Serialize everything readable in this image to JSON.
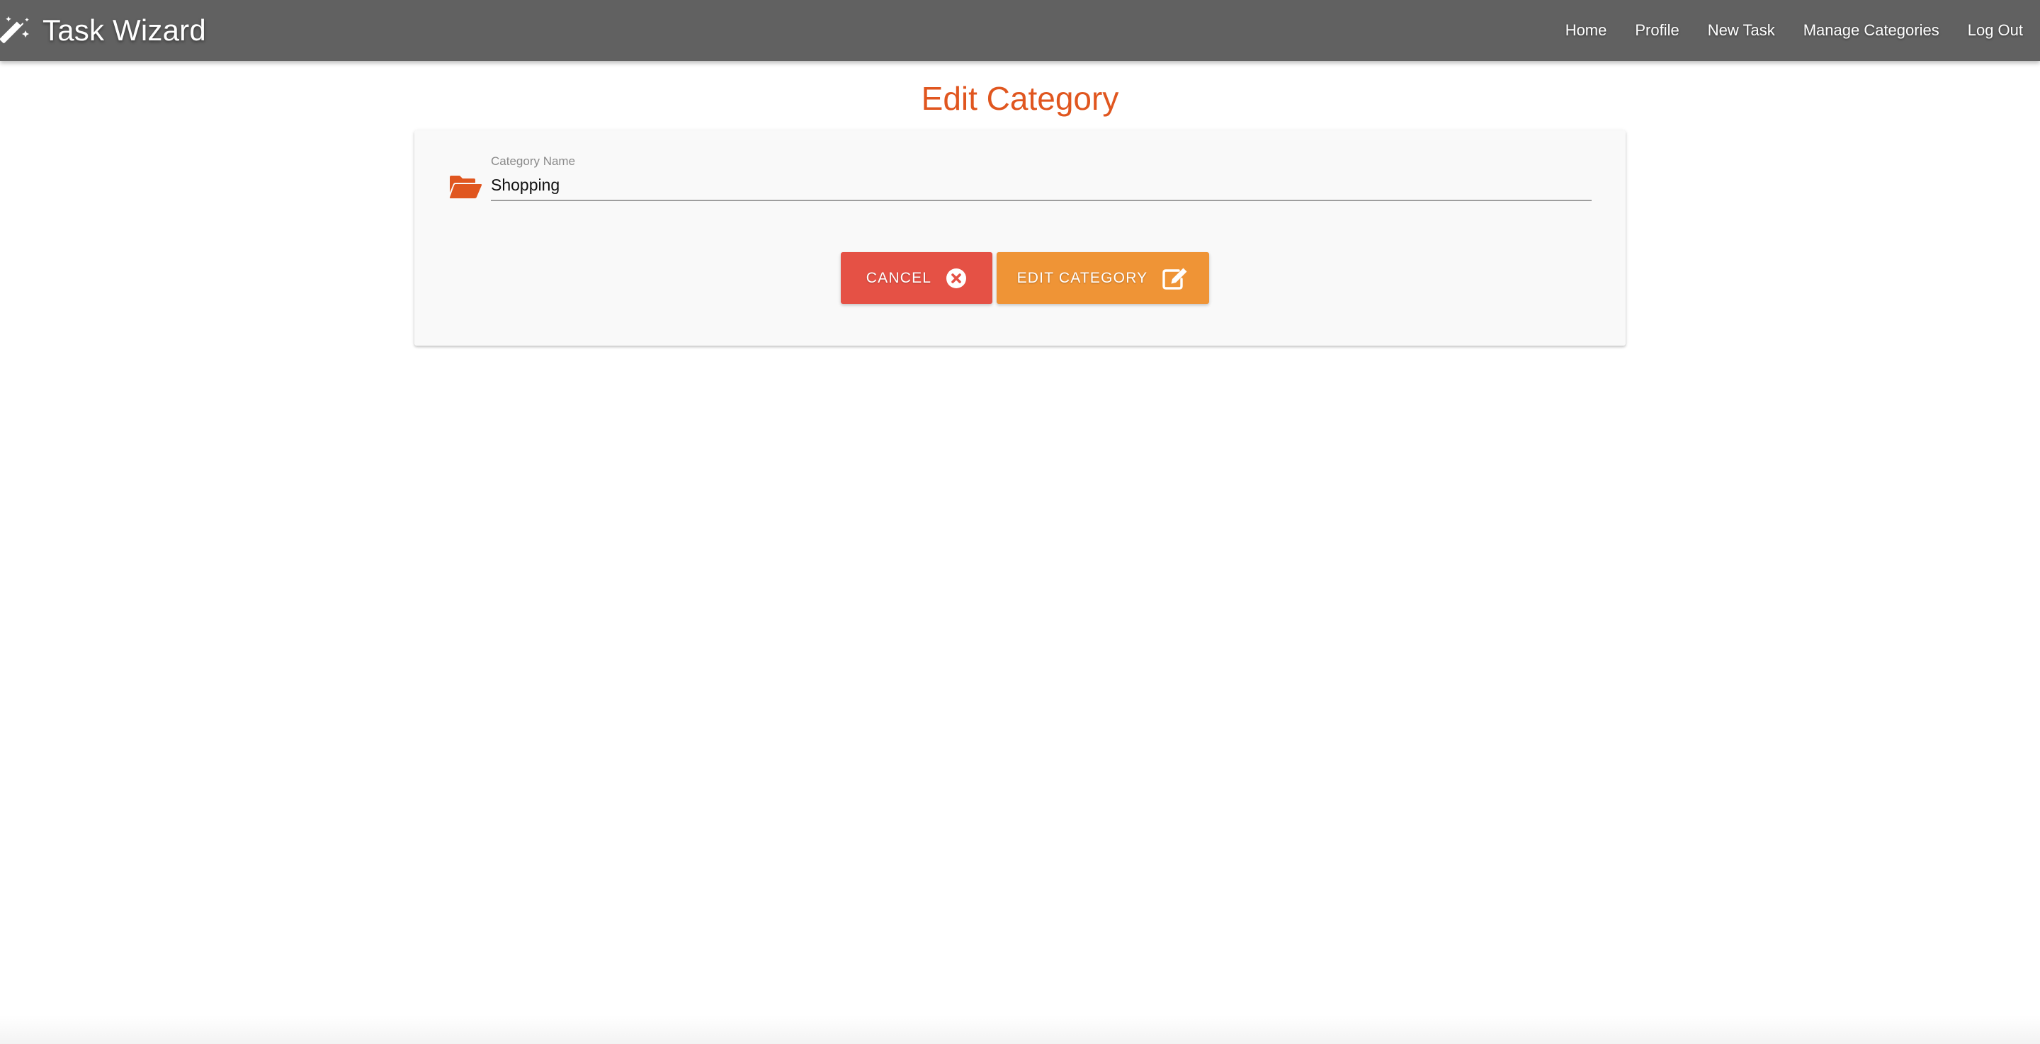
{
  "navbar": {
    "brand_title": "Task Wizard",
    "brand_icon": "magic-wand-icon",
    "links": [
      "Home",
      "Profile",
      "New Task",
      "Manage Categories",
      "Log Out"
    ]
  },
  "page": {
    "title": "Edit Category"
  },
  "form": {
    "field_icon": "folder-open-icon",
    "category_name_label": "Category Name",
    "category_name_value": "Shopping",
    "cancel_label": "Cancel",
    "cancel_icon": "close-circle-icon",
    "submit_label": "Edit Category",
    "submit_icon": "edit-icon"
  },
  "colors": {
    "navbar": "#616161",
    "accent": "#e0561f",
    "cancel": "#e55145",
    "submit": "#ef9436",
    "card": "#f9f9f9"
  }
}
